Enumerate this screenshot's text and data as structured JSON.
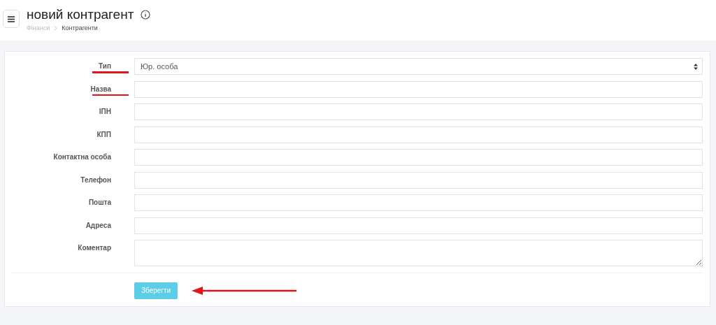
{
  "header": {
    "title": "новий контрагент",
    "breadcrumb": [
      {
        "label": "Фінанси",
        "current": false
      },
      {
        "label": "Контрагенти",
        "current": true
      }
    ]
  },
  "form": {
    "fields": [
      {
        "label": "Тип",
        "kind": "select",
        "value": "Юр. особа",
        "underlined": true
      },
      {
        "label": "Назва",
        "kind": "text",
        "underlined": true
      },
      {
        "label": "ІПН",
        "kind": "text",
        "underlined": false
      },
      {
        "label": "КПП",
        "kind": "text",
        "underlined": false
      },
      {
        "label": "Контактна особа",
        "kind": "text",
        "underlined": false
      },
      {
        "label": "Телефон",
        "kind": "text",
        "underlined": false
      },
      {
        "label": "Пошта",
        "kind": "text",
        "underlined": false
      },
      {
        "label": "Адреса",
        "kind": "text",
        "underlined": false
      },
      {
        "label": "Коментар",
        "kind": "textarea",
        "underlined": false
      }
    ],
    "submit": {
      "label": "Зберегти",
      "arrow_pointer": true
    }
  }
}
